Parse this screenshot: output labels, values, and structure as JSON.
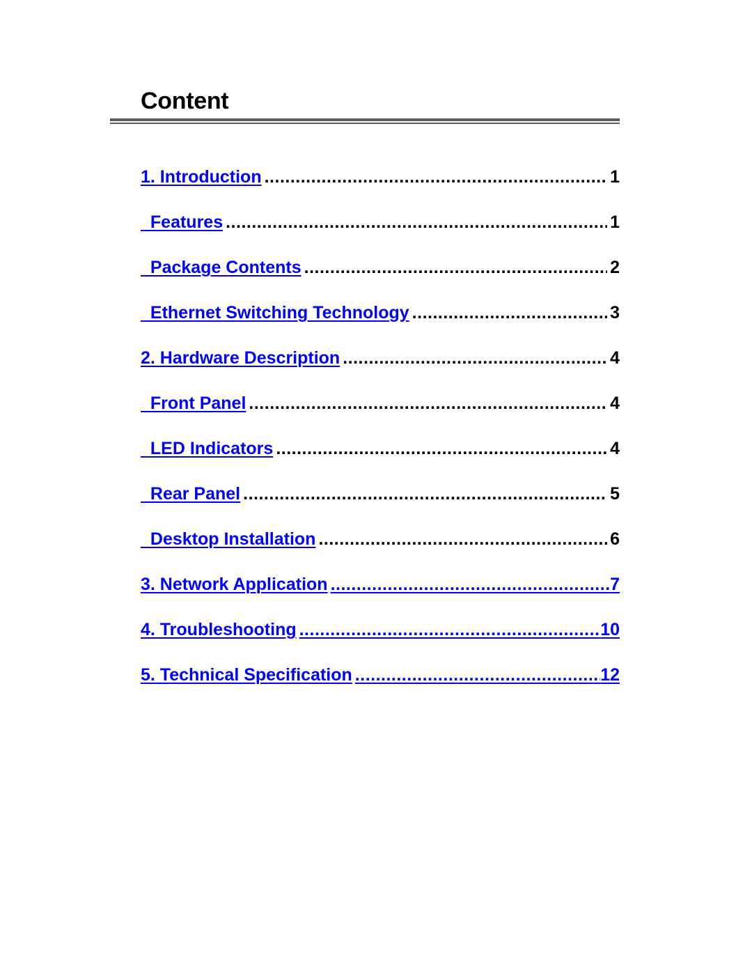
{
  "page": {
    "title": "Content"
  },
  "toc": {
    "entries": [
      {
        "label": "1. Introduction",
        "page": "1",
        "style": "section"
      },
      {
        "label": "  Features",
        "page": "1",
        "style": "section"
      },
      {
        "label": "  Package Contents",
        "page": "2",
        "style": "section"
      },
      {
        "label": "  Ethernet Switching Technology",
        "page": "3",
        "style": "section"
      },
      {
        "label": "2. Hardware Description",
        "page": "4",
        "style": "section"
      },
      {
        "label": "  Front Panel",
        "page": "4",
        "style": "section"
      },
      {
        "label": "  LED Indicators",
        "page": "4",
        "style": "section"
      },
      {
        "label": "  Rear Panel",
        "page": "5",
        "style": "section"
      },
      {
        "label": "  Desktop Installation",
        "page": "6",
        "style": "section"
      },
      {
        "label": "3. Network Application",
        "page": "7",
        "style": "full-link"
      },
      {
        "label": "4. Troubleshooting",
        "page": "10",
        "style": "full-link"
      },
      {
        "label": "5. Technical Specification",
        "page": "12",
        "style": "full-link"
      }
    ]
  },
  "colors": {
    "link": "#0000ff",
    "text": "#000000",
    "rule": "#5a5a5a"
  }
}
